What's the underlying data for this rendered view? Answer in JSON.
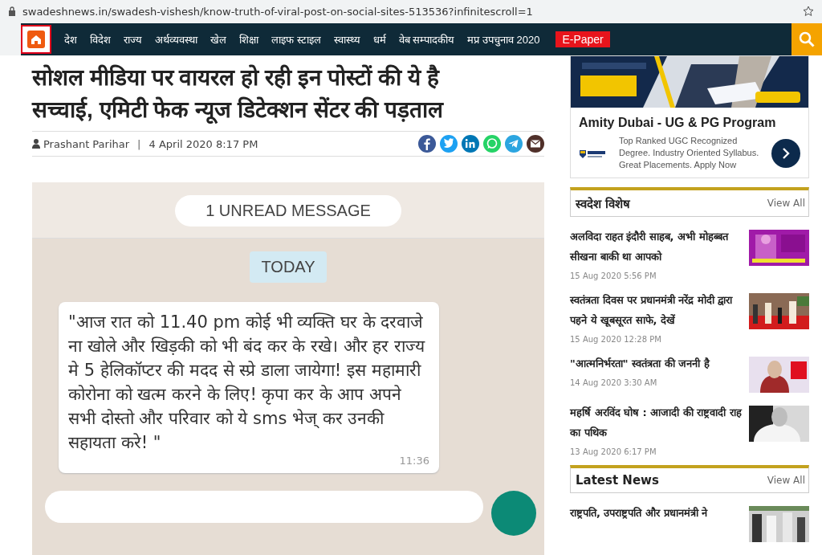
{
  "browser": {
    "url": "swadeshnews.in/swadesh-vishesh/know-truth-of-viral-post-on-social-sites-513536?infinitescroll=1"
  },
  "nav": {
    "items": [
      "देश",
      "विदेश",
      "राज्य",
      "अर्थव्यवस्था",
      "खेल",
      "शिक्षा",
      "लाइफ स्टाइल",
      "स्वास्थ्य",
      "धर्म",
      "वेब सम्पादकीय",
      "मप्र उपचुनाव 2020"
    ],
    "epaper": "E-Paper"
  },
  "article": {
    "headline": "सोशल मीडिया पर वायरल हो रही इन पोस्टों की ये है सच्चाई, एमिटी फेक न्यूज डिटेक्शन सेंटर की पड़ताल",
    "author": "Prashant Parihar",
    "separator": "|",
    "date": "4 April 2020 8:17 PM",
    "image": {
      "unread": "1 UNREAD MESSAGE",
      "day": "TODAY",
      "message": "\"आज रात को 11.40 pm कोई भी व्यक्ति घर के दरवाजे ना खोले और खिड़की को भी बंद कर के रखे। और हर राज्य मे 5 हेलिकॉप्टर की मदद से स्प्रे डाला जायेगा! इस महामारी कोरोना को खत्म करने के लिए! कृपा कर के आप अपने सभी दोस्तो और परिवार को ये sms भेज् कर उनकी सहायता करे! \"",
      "time": "11:36"
    }
  },
  "ad": {
    "title": "Amity Dubai - UG & PG Program",
    "text": "Top Ranked UGC Recognized Degree. Industry Oriented Syllabus. Great Placements. Apply Now"
  },
  "sections": [
    {
      "title": "स्वदेश विशेष",
      "view_all": "View All",
      "items": [
        {
          "title": "अलविदा राहत इंदौरी साहब, अभी मोहब्बत सीखना बाकी था आपको",
          "date": "15 Aug 2020 5:56 PM"
        },
        {
          "title": "स्वतंत्रता दिवस पर प्रधानमंत्री नरेंद्र मोदी द्वारा पहने ये खूबसूरत साफे, देखें",
          "date": "15 Aug 2020 12:28 PM"
        },
        {
          "title": "\"आत्मनिर्भरता\" स्वतंत्रता की जननी है",
          "date": "14 Aug 2020 3:30 AM"
        },
        {
          "title": "महर्षि अरविंद घोष : आजादी की राष्ट्रवादी राह का पथिक",
          "date": "13 Aug 2020 6:17 PM"
        }
      ]
    },
    {
      "title": "Latest News",
      "view_all": "View All",
      "items": [
        {
          "title": "राष्ट्रपति, उपराष्ट्रपति और प्रधानमंत्री ने"
        }
      ]
    }
  ]
}
